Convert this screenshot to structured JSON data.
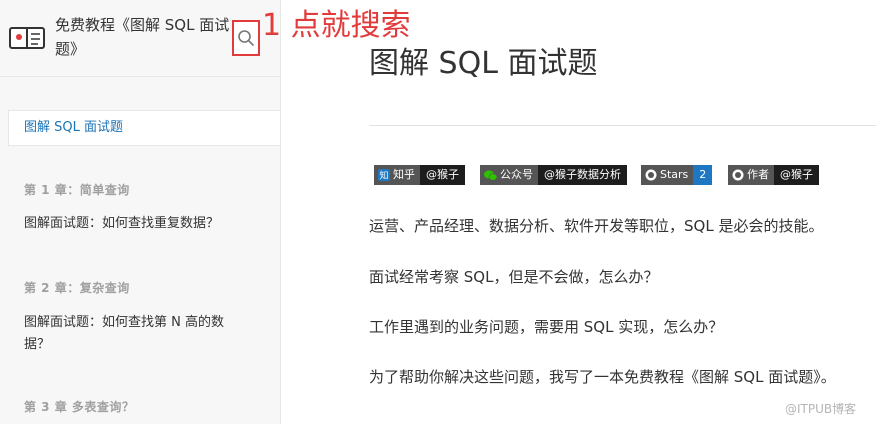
{
  "sidebar": {
    "book_title": "免费教程《图解 SQL 面试题》",
    "active_item": "图解 SQL 面试题",
    "chapters": [
      {
        "heading": "第 1 章：简单查询",
        "item": "图解面试题：如何查找重复数据？"
      },
      {
        "heading": "第 2 章：复杂查询",
        "item": "图解面试题：如何查找第 N 高的数据？"
      },
      {
        "heading": "第 3 章 多表查询？",
        "item": ""
      }
    ]
  },
  "annotation": "1 点就搜索",
  "main": {
    "title": "图解 SQL 面试题",
    "badges": [
      {
        "icon": "zhihu-icon",
        "label": "知乎",
        "value": "@猴子"
      },
      {
        "icon": "wechat-icon",
        "label": "公众号",
        "value": "@猴子数据分析"
      },
      {
        "icon": "github-icon",
        "label": "Stars",
        "value": "2"
      },
      {
        "icon": "github-icon",
        "label": "作者",
        "value": "@猴子"
      }
    ],
    "paragraphs": [
      "运营、产品经理、数据分析、软件开发等职位，SQL 是必会的技能。",
      "面试经常考察 SQL，但是不会做，怎么办？",
      "工作里遇到的业务问题，需要用 SQL 实现，怎么办？",
      "为了帮助你解决这些问题，我写了一本免费教程《图解 SQL 面试题》。"
    ]
  },
  "watermark": "@ITPUB博客",
  "colors": {
    "accent": "#1a73b6",
    "annotation_red": "#e23b3b",
    "badge_left": "#555555",
    "badge_right": "#1d1d1d",
    "badge_blue": "#1e77c3"
  }
}
